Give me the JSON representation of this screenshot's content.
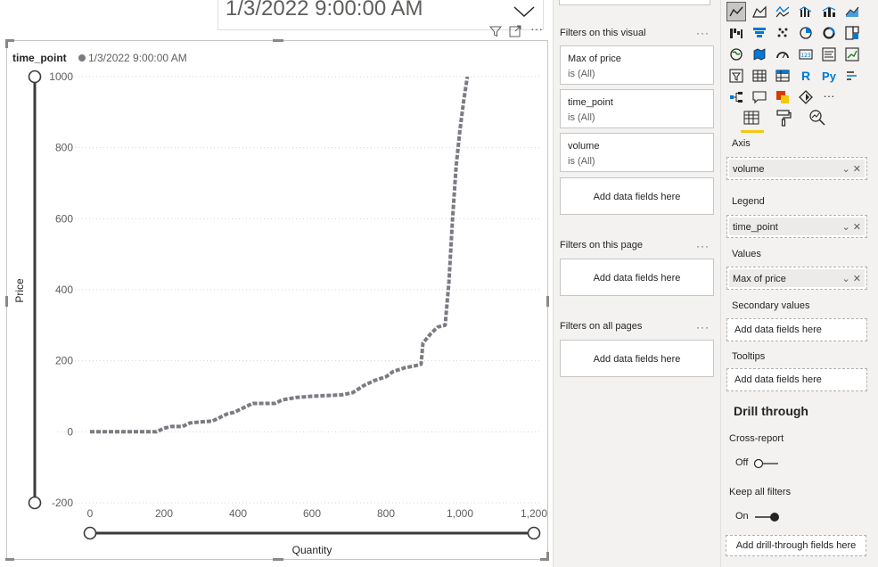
{
  "slicer": {
    "value": "1/3/2022 9:00:00 AM"
  },
  "visual": {
    "legend_title": "time_point",
    "legend_item": "1/3/2022 9:00:00 AM",
    "ylabel": "Price",
    "xlabel": "Quantity"
  },
  "chart_data": {
    "type": "line",
    "xlabel": "Quantity",
    "ylabel": "Price",
    "xlim": [
      0,
      1200
    ],
    "ylim": [
      -200,
      1000
    ],
    "x_ticks": [
      "0",
      "200",
      "400",
      "600",
      "800",
      "1,000",
      "1,200"
    ],
    "y_ticks": [
      "1000",
      "800",
      "600",
      "400",
      "200",
      "0",
      "-200"
    ],
    "legend": {
      "title": "time_point",
      "placement": "top-left"
    },
    "grid": true,
    "series": [
      {
        "name": "1/3/2022 9:00:00 AM",
        "color": "#7a7c82",
        "points": [
          [
            0,
            0
          ],
          [
            100,
            0
          ],
          [
            180,
            0
          ],
          [
            200,
            10
          ],
          [
            220,
            15
          ],
          [
            250,
            15
          ],
          [
            270,
            25
          ],
          [
            300,
            28
          ],
          [
            330,
            30
          ],
          [
            350,
            40
          ],
          [
            370,
            50
          ],
          [
            390,
            55
          ],
          [
            420,
            70
          ],
          [
            440,
            80
          ],
          [
            470,
            80
          ],
          [
            500,
            80
          ],
          [
            520,
            90
          ],
          [
            560,
            97
          ],
          [
            600,
            100
          ],
          [
            640,
            102
          ],
          [
            680,
            104
          ],
          [
            710,
            110
          ],
          [
            740,
            130
          ],
          [
            770,
            145
          ],
          [
            800,
            155
          ],
          [
            820,
            170
          ],
          [
            850,
            180
          ],
          [
            880,
            186
          ],
          [
            895,
            190
          ],
          [
            900,
            250
          ],
          [
            920,
            275
          ],
          [
            940,
            295
          ],
          [
            960,
            300
          ],
          [
            970,
            420
          ],
          [
            980,
            600
          ],
          [
            990,
            750
          ],
          [
            1000,
            850
          ],
          [
            1010,
            930
          ],
          [
            1020,
            1000
          ]
        ]
      }
    ]
  },
  "filters": {
    "on_visual_title": "Filters on this visual",
    "cards": [
      {
        "name": "Max of price",
        "state": "is (All)"
      },
      {
        "name": "time_point",
        "state": "is (All)"
      },
      {
        "name": "volume",
        "state": "is (All)"
      }
    ],
    "add_label": "Add data fields here",
    "on_page_title": "Filters on this page",
    "on_all_title": "Filters on all pages",
    "dots": "···"
  },
  "viz": {
    "wells": {
      "axis_label": "Axis",
      "axis_field": "volume",
      "legend_label": "Legend",
      "legend_field": "time_point",
      "values_label": "Values",
      "values_field": "Max of price",
      "secondary_label": "Secondary values",
      "tooltips_label": "Tooltips",
      "add_label": "Add data fields here"
    },
    "drill": {
      "title": "Drill through",
      "cross_report": "Cross-report",
      "cross_state": "Off",
      "keep_filters": "Keep all filters",
      "keep_state": "On",
      "add_label": "Add drill-through fields here"
    },
    "more": "···",
    "r_label": "R",
    "py_label": "Py"
  },
  "colors": {
    "accent": "#f2c811",
    "line": "#7a7c82",
    "slider": "#3b3a39"
  }
}
